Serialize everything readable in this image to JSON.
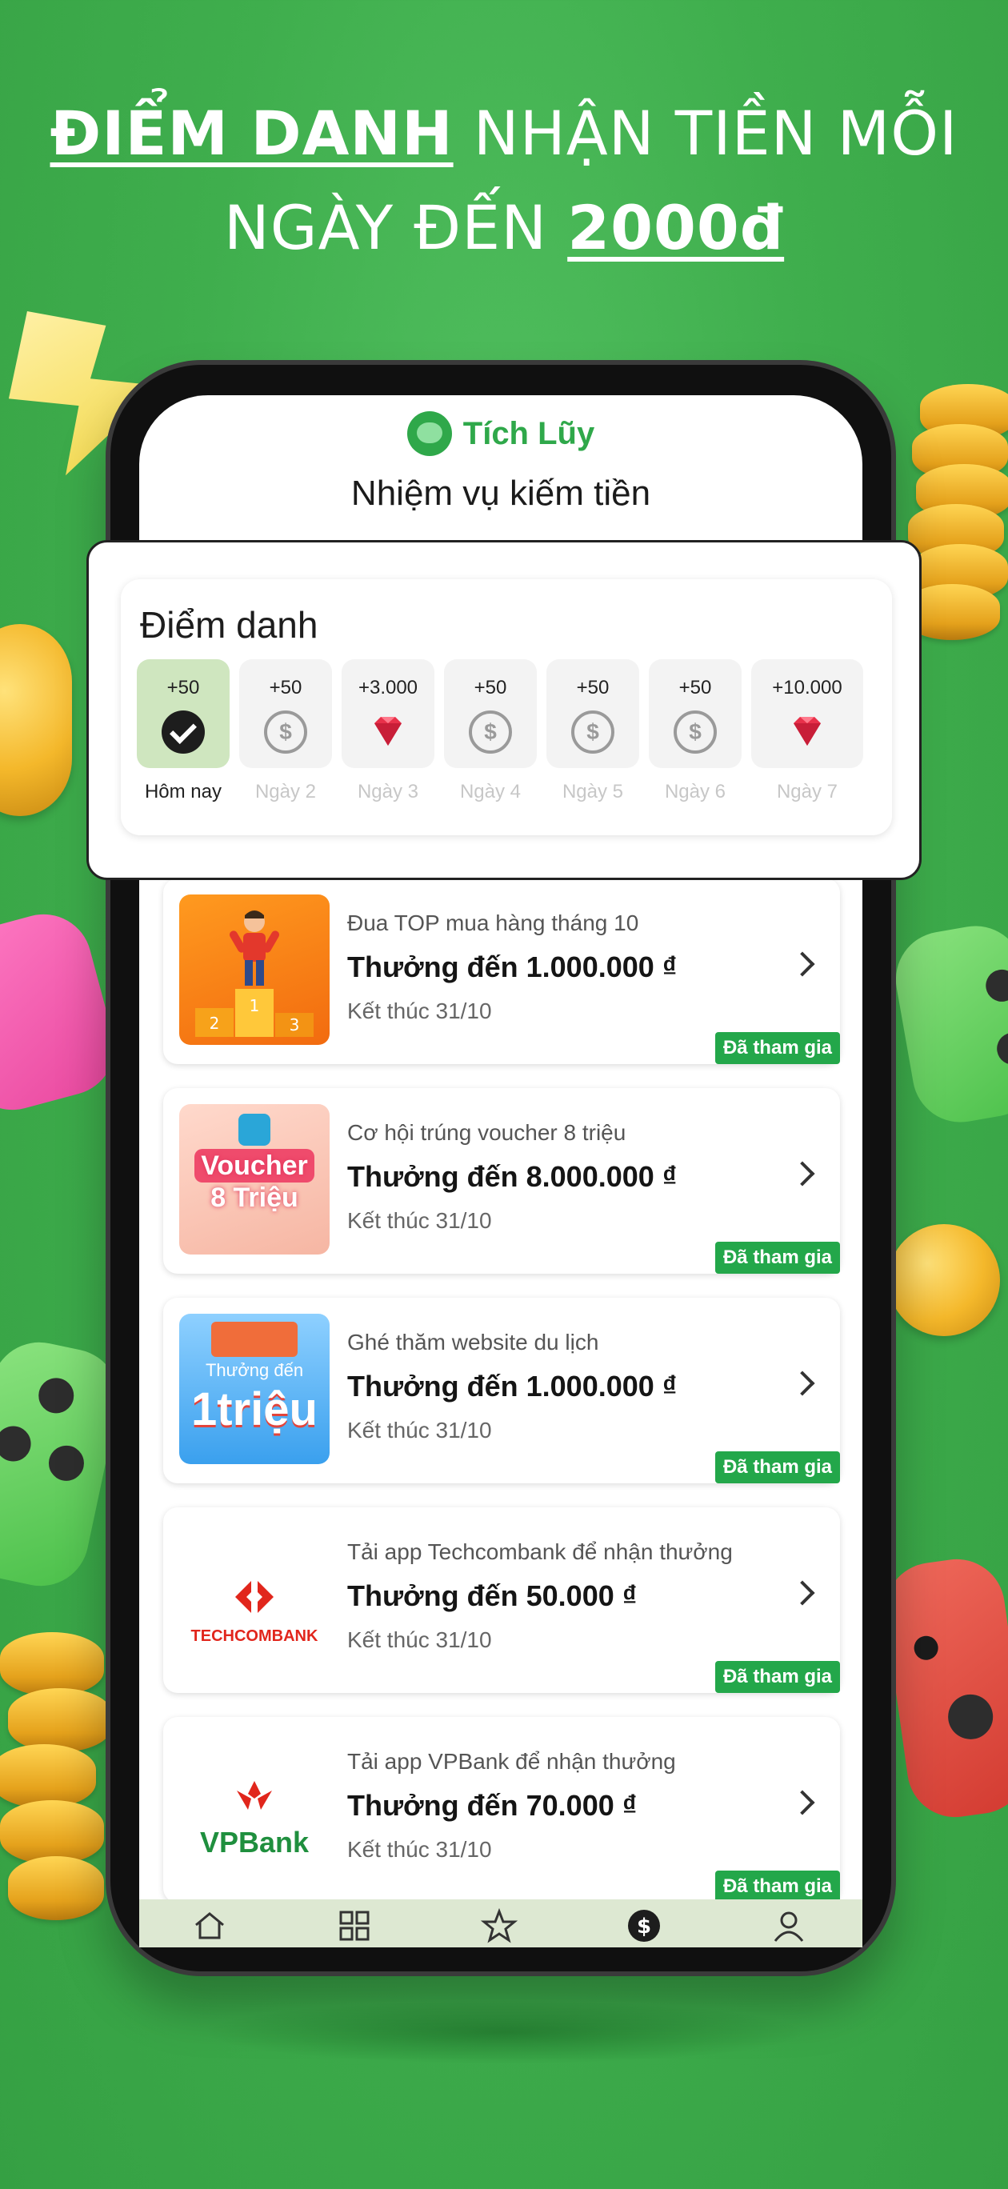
{
  "headline": {
    "part1_em": "ĐIỂM DANH",
    "part1_rest": " NHẬN TIỀN MỖI",
    "part2_rest": "NGÀY ĐẾN ",
    "part2_em": "2000đ"
  },
  "app": {
    "brand": "Tích Lũy",
    "title": "Nhiệm vụ kiếm tiền",
    "brand_color": "#2fa84a",
    "accent_badge_color": "#23a74a"
  },
  "checkin": {
    "title": "Điểm danh",
    "days": [
      {
        "amount": "+50",
        "label": "Hôm nay",
        "icon": "check-icon",
        "state": "done"
      },
      {
        "amount": "+50",
        "label": "Ngày 2",
        "icon": "coin-icon",
        "state": "pending"
      },
      {
        "amount": "+3.000",
        "label": "Ngày 3",
        "icon": "gem-icon",
        "state": "pending"
      },
      {
        "amount": "+50",
        "label": "Ngày 4",
        "icon": "coin-icon",
        "state": "pending"
      },
      {
        "amount": "+50",
        "label": "Ngày 5",
        "icon": "coin-icon",
        "state": "pending"
      },
      {
        "amount": "+50",
        "label": "Ngày 6",
        "icon": "coin-icon",
        "state": "pending"
      },
      {
        "amount": "+10.000",
        "label": "Ngày 7",
        "icon": "gem-icon",
        "state": "pending"
      }
    ]
  },
  "tasks": [
    {
      "subtitle": "Đua TOP mua hàng tháng 10",
      "reward": "Thưởng đến 1.000.000 ₫",
      "ends": "Kết thúc 31/10",
      "badge": "Đã tham gia",
      "thumb_text": [
        "1",
        "2",
        "3"
      ]
    },
    {
      "subtitle": "Cơ hội trúng voucher 8 triệu",
      "reward": "Thưởng đến 8.000.000 ₫",
      "ends": "Kết thúc 31/10",
      "badge": "Đã tham gia",
      "thumb_text": [
        "Voucher",
        "8 Triệu"
      ]
    },
    {
      "subtitle": "Ghé thăm website du lịch",
      "reward": "Thưởng đến 1.000.000 ₫",
      "ends": "Kết thúc 31/10",
      "badge": "Đã tham gia",
      "thumb_text": [
        "Thưởng đến",
        "1triệu"
      ]
    },
    {
      "subtitle": "Tải app Techcombank để nhận thưởng",
      "reward": "Thưởng đến 50.000 ₫",
      "ends": "Kết thúc 31/10",
      "badge": "Đã tham gia",
      "thumb_text": [
        "TECHCOMBANK"
      ]
    },
    {
      "subtitle": "Tải app VPBank để nhận thưởng",
      "reward": "Thưởng đến 70.000 ₫",
      "ends": "Kết thúc 31/10",
      "badge": "Đã tham gia",
      "thumb_text": [
        "VPBank"
      ]
    }
  ],
  "nav": [
    "home-icon",
    "grid-icon",
    "star-icon",
    "dollar-icon",
    "profile-icon"
  ]
}
